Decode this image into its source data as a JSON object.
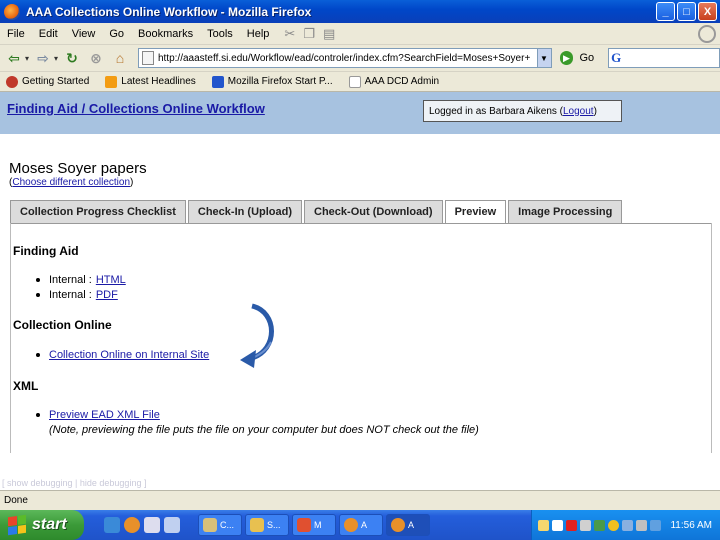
{
  "window": {
    "title": "AAA Collections Online Workflow - Mozilla Firefox",
    "minimize": "_",
    "maximize": "□",
    "close": "X"
  },
  "menu": [
    "File",
    "Edit",
    "View",
    "Go",
    "Bookmarks",
    "Tools",
    "Help"
  ],
  "nav": {
    "url": "http://aaasteff.si.edu/Workflow/ead/controler/index.cfm?SearchField=Moses+Soyer+",
    "go_label": "Go",
    "search_engine_icon": "G"
  },
  "bookmarks": [
    {
      "label": "Getting Started",
      "icon": "firefox-icon",
      "color": "#c0392b"
    },
    {
      "label": "Latest Headlines",
      "icon": "rss-icon",
      "color": "#f39c12"
    },
    {
      "label": "Mozilla Firefox Start P...",
      "icon": "google-icon",
      "color": "#2255cc"
    },
    {
      "label": "AAA DCD Admin",
      "icon": "page-icon",
      "color": "#dddddd"
    }
  ],
  "header": {
    "breadcrumb": "Finding Aid / Collections Online Workflow",
    "login_prefix": "Logged in as",
    "user_name": "Barbara Aikens",
    "logout_label": "Logout"
  },
  "collection": {
    "title": "Moses Soyer papers",
    "choose_label": "Choose different collection"
  },
  "tabs": [
    {
      "label": "Collection Progress Checklist",
      "active": false
    },
    {
      "label": "Check-In (Upload)",
      "active": false
    },
    {
      "label": "Check-Out (Download)",
      "active": false
    },
    {
      "label": "Preview",
      "active": true
    },
    {
      "label": "Image Processing",
      "active": false
    }
  ],
  "finding_aid": {
    "heading": "Finding Aid",
    "items": [
      {
        "prefix": "Internal :",
        "link": "HTML"
      },
      {
        "prefix": "Internal :",
        "link": "PDF"
      }
    ]
  },
  "collection_online": {
    "heading": "Collection Online",
    "link": "Collection Online on Internal Site"
  },
  "xml": {
    "heading": "XML",
    "link": "Preview EAD XML File",
    "note": "(Note, previewing the file puts the file on your computer but does NOT check out the file)"
  },
  "footer": "[ show debugging | hide debugging ]",
  "status": "Done",
  "taskbar": {
    "start_label": "start",
    "tasks": [
      {
        "label": "C...",
        "icon_color": "#d8c07a"
      },
      {
        "label": "S...",
        "icon_color": "#e8c050"
      },
      {
        "label": "M",
        "icon_color": "#e05030"
      },
      {
        "label": "A",
        "icon_color": "#e8902a"
      },
      {
        "label": "A",
        "icon_color": "#e8902a"
      }
    ],
    "clock": "11:56 AM"
  }
}
